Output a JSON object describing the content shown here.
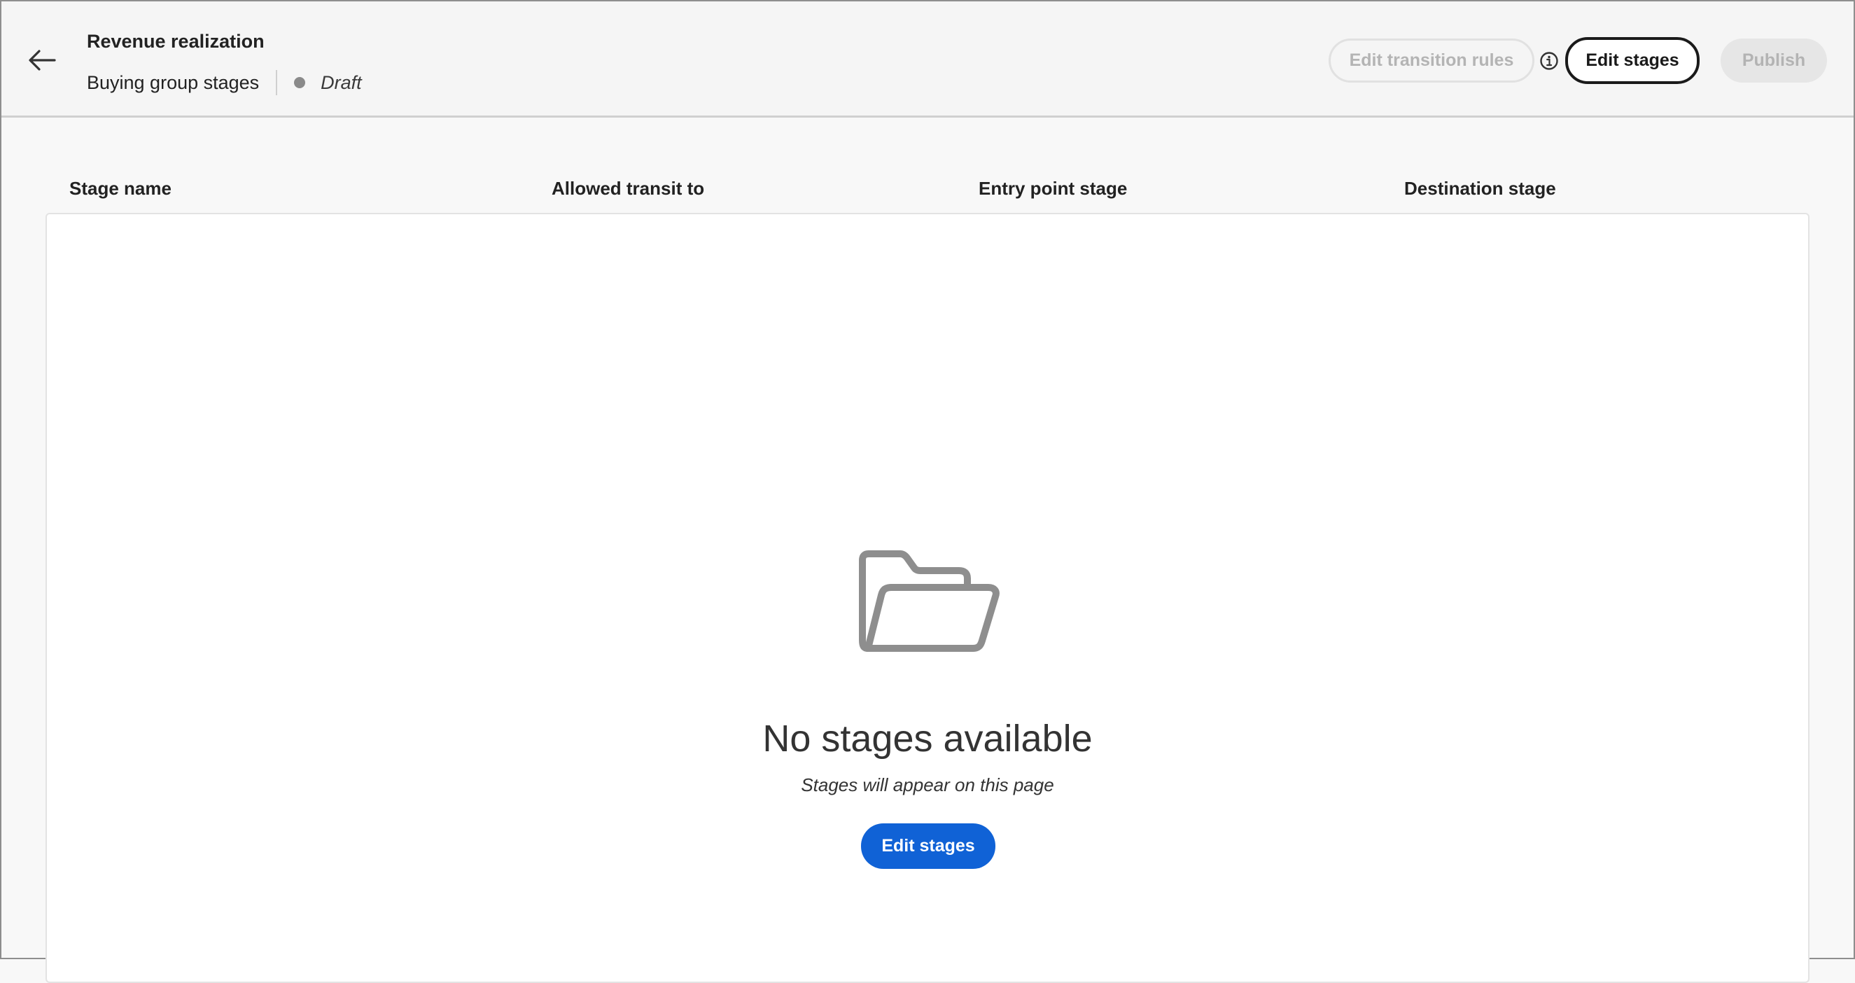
{
  "header": {
    "title": "Revenue realization",
    "subtitle": "Buying group stages",
    "status": "Draft",
    "status_color": "#8a8a8a",
    "actions": {
      "edit_transition_rules_label": "Edit transition rules",
      "edit_stages_label": "Edit stages",
      "publish_label": "Publish"
    },
    "icons": {
      "back": "arrow-left-icon",
      "info": "info-icon"
    }
  },
  "table": {
    "columns": [
      "Stage name",
      "Allowed transit to",
      "Entry point stage",
      "Destination stage"
    ],
    "rows": []
  },
  "empty_state": {
    "icon": "folder-open-icon",
    "title": "No stages available",
    "subtitle": "Stages will appear on this page",
    "button_label": "Edit stages"
  },
  "colors": {
    "primary_button": "#1062d6",
    "background": "#f8f8f8"
  }
}
